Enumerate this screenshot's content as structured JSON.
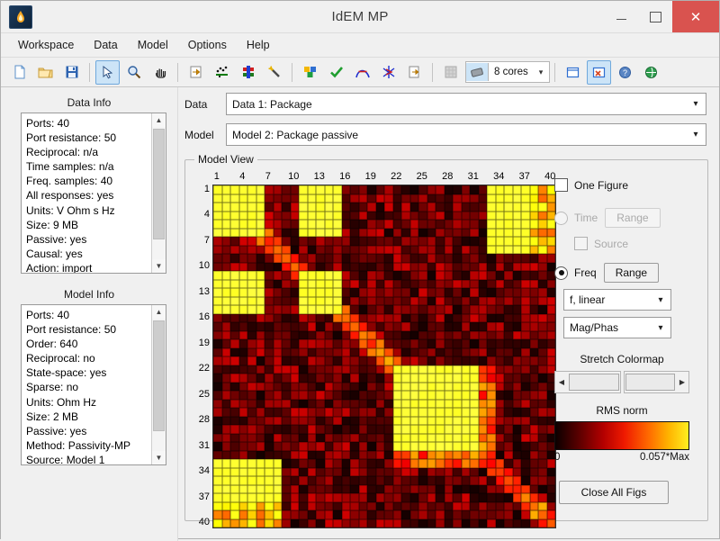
{
  "window": {
    "title": "IdEM MP",
    "app_icon": "flame-icon",
    "minimize": "minimize-icon",
    "maximize": "maximize-icon",
    "close": "close-icon"
  },
  "menubar": {
    "items": [
      {
        "label": "Workspace"
      },
      {
        "label": "Data"
      },
      {
        "label": "Model"
      },
      {
        "label": "Options"
      },
      {
        "label": "Help"
      }
    ]
  },
  "toolbar": {
    "buttons": [
      {
        "name": "new-file-icon",
        "group": 1
      },
      {
        "name": "open-folder-icon",
        "group": 1
      },
      {
        "name": "save-icon",
        "group": 1
      },
      {
        "name": "pointer-icon",
        "group": 2,
        "active": true
      },
      {
        "name": "zoom-icon",
        "group": 2
      },
      {
        "name": "pan-hand-icon",
        "group": 2
      },
      {
        "name": "export-icon",
        "group": 3
      },
      {
        "name": "data-points-icon",
        "group": 3
      },
      {
        "name": "matrix-icon",
        "group": 3
      },
      {
        "name": "wand-icon",
        "group": 3
      },
      {
        "name": "blocks-icon",
        "group": 4
      },
      {
        "name": "check-icon",
        "group": 4
      },
      {
        "name": "arc-icon",
        "group": 4
      },
      {
        "name": "star-icon",
        "group": 4
      },
      {
        "name": "page-export-icon",
        "group": 4
      },
      {
        "name": "grid-disabled-icon",
        "group": 5,
        "disabled": true
      }
    ],
    "cores": {
      "icon": "cpu-icon",
      "label": "8 cores",
      "arrow": "chevron-down-icon"
    },
    "right_buttons": [
      {
        "name": "window-icon"
      },
      {
        "name": "close-figures-icon",
        "active": true
      },
      {
        "name": "help-icon"
      },
      {
        "name": "globe-icon"
      }
    ]
  },
  "left_panel": {
    "data_info": {
      "title": "Data Info",
      "lines": [
        "Ports: 40",
        "Port resistance: 50",
        "Reciprocal: n/a",
        "Time samples: n/a",
        "Freq. samples: 40",
        "All responses: yes",
        "Units: V Ohm s Hz",
        "Size: 9 MB",
        "Passive: yes",
        "Causal: yes",
        "Action: import"
      ]
    },
    "model_info": {
      "title": "Model Info",
      "lines": [
        "Ports: 40",
        "Port resistance: 50",
        "Order: 640",
        "Reciprocal: no",
        "State-space: yes",
        "Sparse: no",
        "Units: Ohm Hz",
        "Size: 2 MB",
        "Passive: yes",
        "Method: Passivity-MP",
        "Source: Model 1"
      ]
    }
  },
  "selectors": {
    "data": {
      "label": "Data",
      "value": "Data 1: Package",
      "arrow": "chevron-down-icon"
    },
    "model": {
      "label": "Model",
      "value": "Model 2: Package passive",
      "arrow": "chevron-down-icon"
    }
  },
  "model_view": {
    "legend": "Model View",
    "controls": {
      "one_figure": {
        "label": "One Figure",
        "checked": false
      },
      "time": {
        "label": "Time",
        "selected": false,
        "disabled": true
      },
      "time_range_button": "Range",
      "source": {
        "label": "Source",
        "checked": false,
        "disabled": true
      },
      "freq": {
        "label": "Freq",
        "selected": true,
        "disabled": false
      },
      "freq_range_button": "Range",
      "axis_select": {
        "value": "f, linear",
        "arrow": "chevron-down-icon"
      },
      "format_select": {
        "value": "Mag/Phas",
        "arrow": "chevron-down-icon"
      },
      "stretch_colormap_label": "Stretch Colormap",
      "slider_left_arrow": "left-arrow-icon",
      "slider_right_arrow": "right-arrow-icon",
      "rms_norm_label": "RMS norm",
      "colorbar_min": "0",
      "colorbar_max": "0.057*Max",
      "close_all_figs": "Close All Figs"
    }
  },
  "chart_data": {
    "type": "heatmap",
    "title": "Model View",
    "xlabel": "",
    "ylabel": "",
    "colorbar_label": "RMS norm",
    "colormap": "hot",
    "vmin": 0,
    "vmax_label": "0.057*Max",
    "grid": true,
    "n_rows": 40,
    "n_cols": 40,
    "xticks": [
      1,
      4,
      7,
      10,
      13,
      16,
      19,
      22,
      25,
      28,
      31,
      34,
      37,
      40
    ],
    "yticks": [
      1,
      4,
      7,
      10,
      13,
      16,
      19,
      22,
      25,
      28,
      31,
      34,
      37,
      40
    ],
    "block_structure": [
      {
        "rows": [
          1,
          6
        ],
        "cols": [
          1,
          6
        ],
        "level": "high"
      },
      {
        "rows": [
          1,
          6
        ],
        "cols": [
          11,
          15
        ],
        "level": "high"
      },
      {
        "rows": [
          11,
          15
        ],
        "cols": [
          1,
          6
        ],
        "level": "high"
      },
      {
        "rows": [
          11,
          15
        ],
        "cols": [
          11,
          15
        ],
        "level": "high"
      },
      {
        "rows": [
          22,
          31
        ],
        "cols": [
          22,
          31
        ],
        "level": "high"
      },
      {
        "rows": [
          33,
          37
        ],
        "cols": [
          1,
          8
        ],
        "level": "high"
      },
      {
        "rows": [
          7,
          10
        ],
        "cols": [
          16,
          21
        ],
        "level": "low"
      },
      {
        "rows": [
          16,
          21
        ],
        "cols": [
          7,
          10
        ],
        "level": "low"
      }
    ],
    "description": "40x40 symmetric block-structured RMS-norm magnitude matrix using the hot colormap; bright yellow diagonal and off-diagonal coupling blocks, dark red/near-black background."
  }
}
